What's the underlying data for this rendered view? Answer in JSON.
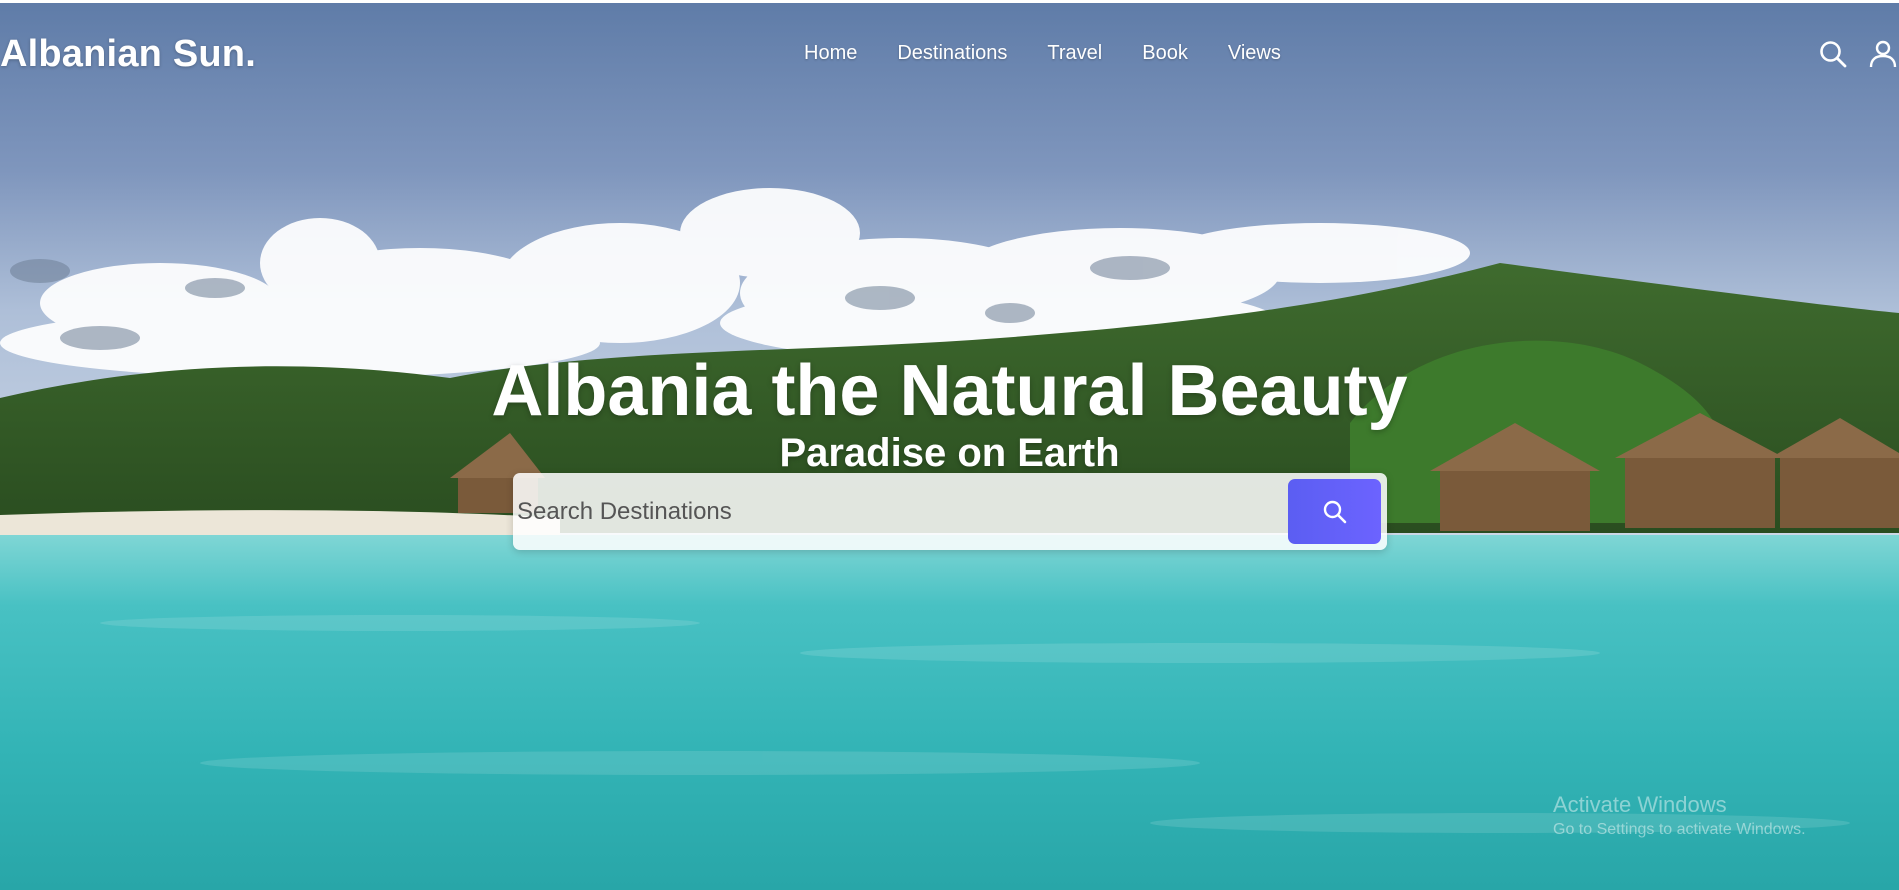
{
  "brand": {
    "logo": "Albanian Sun."
  },
  "nav": {
    "items": [
      {
        "label": "Home"
      },
      {
        "label": "Destinations"
      },
      {
        "label": "Travel"
      },
      {
        "label": "Book"
      },
      {
        "label": "Views"
      }
    ]
  },
  "header_icons": [
    "search-icon",
    "user-icon"
  ],
  "hero": {
    "title": "Albania the Natural Beauty",
    "subtitle": "Paradise on Earth",
    "search": {
      "placeholder": "Search Destinations",
      "value": ""
    }
  },
  "colors": {
    "accent": "#6366f1",
    "text_on_hero": "#ffffff"
  },
  "os_overlay": {
    "title": "Activate Windows",
    "subtitle": "Go to Settings to activate Windows."
  }
}
